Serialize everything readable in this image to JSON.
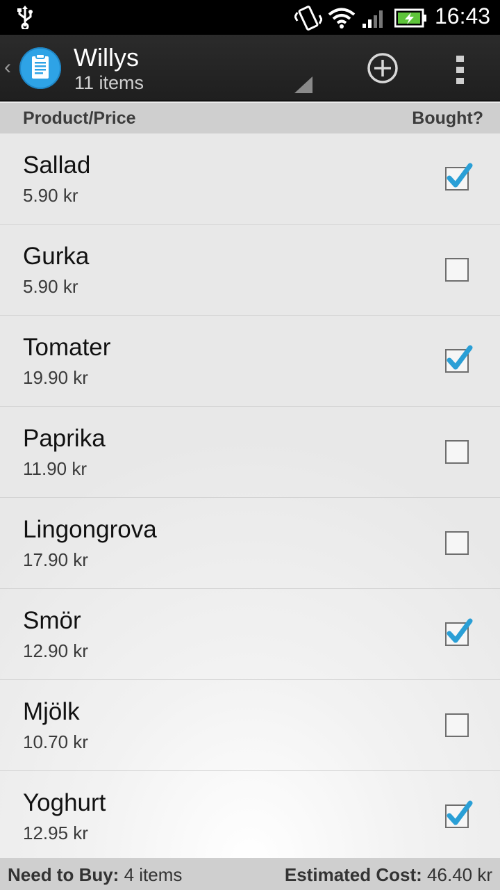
{
  "status_bar": {
    "time": "16:43",
    "icons": [
      "usb-icon",
      "vibrate-icon",
      "wifi-icon",
      "signal-icon",
      "battery-charging-icon"
    ]
  },
  "action_bar": {
    "title": "Willys",
    "subtitle": "11 items",
    "app_icon": "clipboard-icon",
    "add_icon": "add-circle-icon",
    "overflow_icon": "overflow-menu-icon",
    "accent": "#2ea3e6"
  },
  "columns": {
    "left": "Product/Price",
    "right": "Bought?"
  },
  "items": [
    {
      "name": "Sallad",
      "price": "5.90 kr",
      "bought": true
    },
    {
      "name": "Gurka",
      "price": "5.90 kr",
      "bought": false
    },
    {
      "name": "Tomater",
      "price": "19.90 kr",
      "bought": true
    },
    {
      "name": "Paprika",
      "price": "11.90 kr",
      "bought": false
    },
    {
      "name": "Lingongrova",
      "price": "17.90 kr",
      "bought": false
    },
    {
      "name": "Smör",
      "price": "12.90 kr",
      "bought": true
    },
    {
      "name": "Mjölk",
      "price": "10.70 kr",
      "bought": false
    },
    {
      "name": "Yoghurt",
      "price": "12.95 kr",
      "bought": true
    }
  ],
  "footer": {
    "need_label": "Need to Buy:",
    "need_value": "4 items",
    "cost_label": "Estimated Cost:",
    "cost_value": "46.40 kr"
  },
  "colors": {
    "check": "#2a9fd6",
    "header_bg": "#cfcfcf"
  }
}
